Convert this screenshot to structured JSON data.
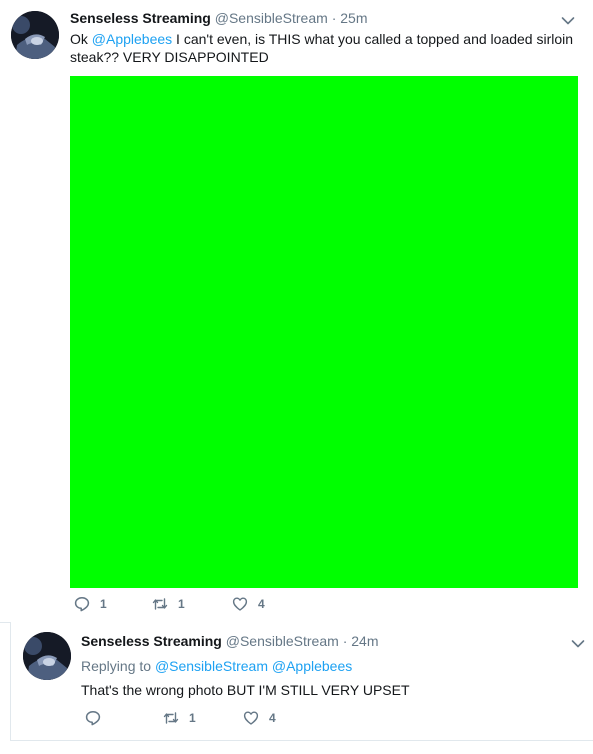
{
  "tweets": [
    {
      "display_name": "Senseless Streaming",
      "handle": "@SensibleStream",
      "separator": "·",
      "time": "25m",
      "text_prefix": "Ok ",
      "text_mention": "@Applebees",
      "text_suffix": " I can't even, is THIS what you called a topped and loaded sirloin steak?? VERY DISAPPOINTED",
      "media_color": "#00ff00",
      "replies": "1",
      "retweets": "1",
      "likes": "4"
    },
    {
      "display_name": "Senseless Streaming",
      "handle": "@SensibleStream",
      "separator": "·",
      "time": "24m",
      "replying_to_label": "Replying to",
      "replying_to_1": "@SensibleStream",
      "replying_to_2": "@Applebees",
      "text": "That's the wrong photo BUT I'M STILL VERY UPSET",
      "replies": "",
      "retweets": "1",
      "likes": "4"
    }
  ],
  "colors": {
    "accent": "#1da1f2",
    "secondary_text": "#657786",
    "media_fill": "#00ff00"
  },
  "icons": [
    "reply-icon",
    "retweet-icon",
    "like-icon",
    "caret-down-icon",
    "avatar-image"
  ]
}
